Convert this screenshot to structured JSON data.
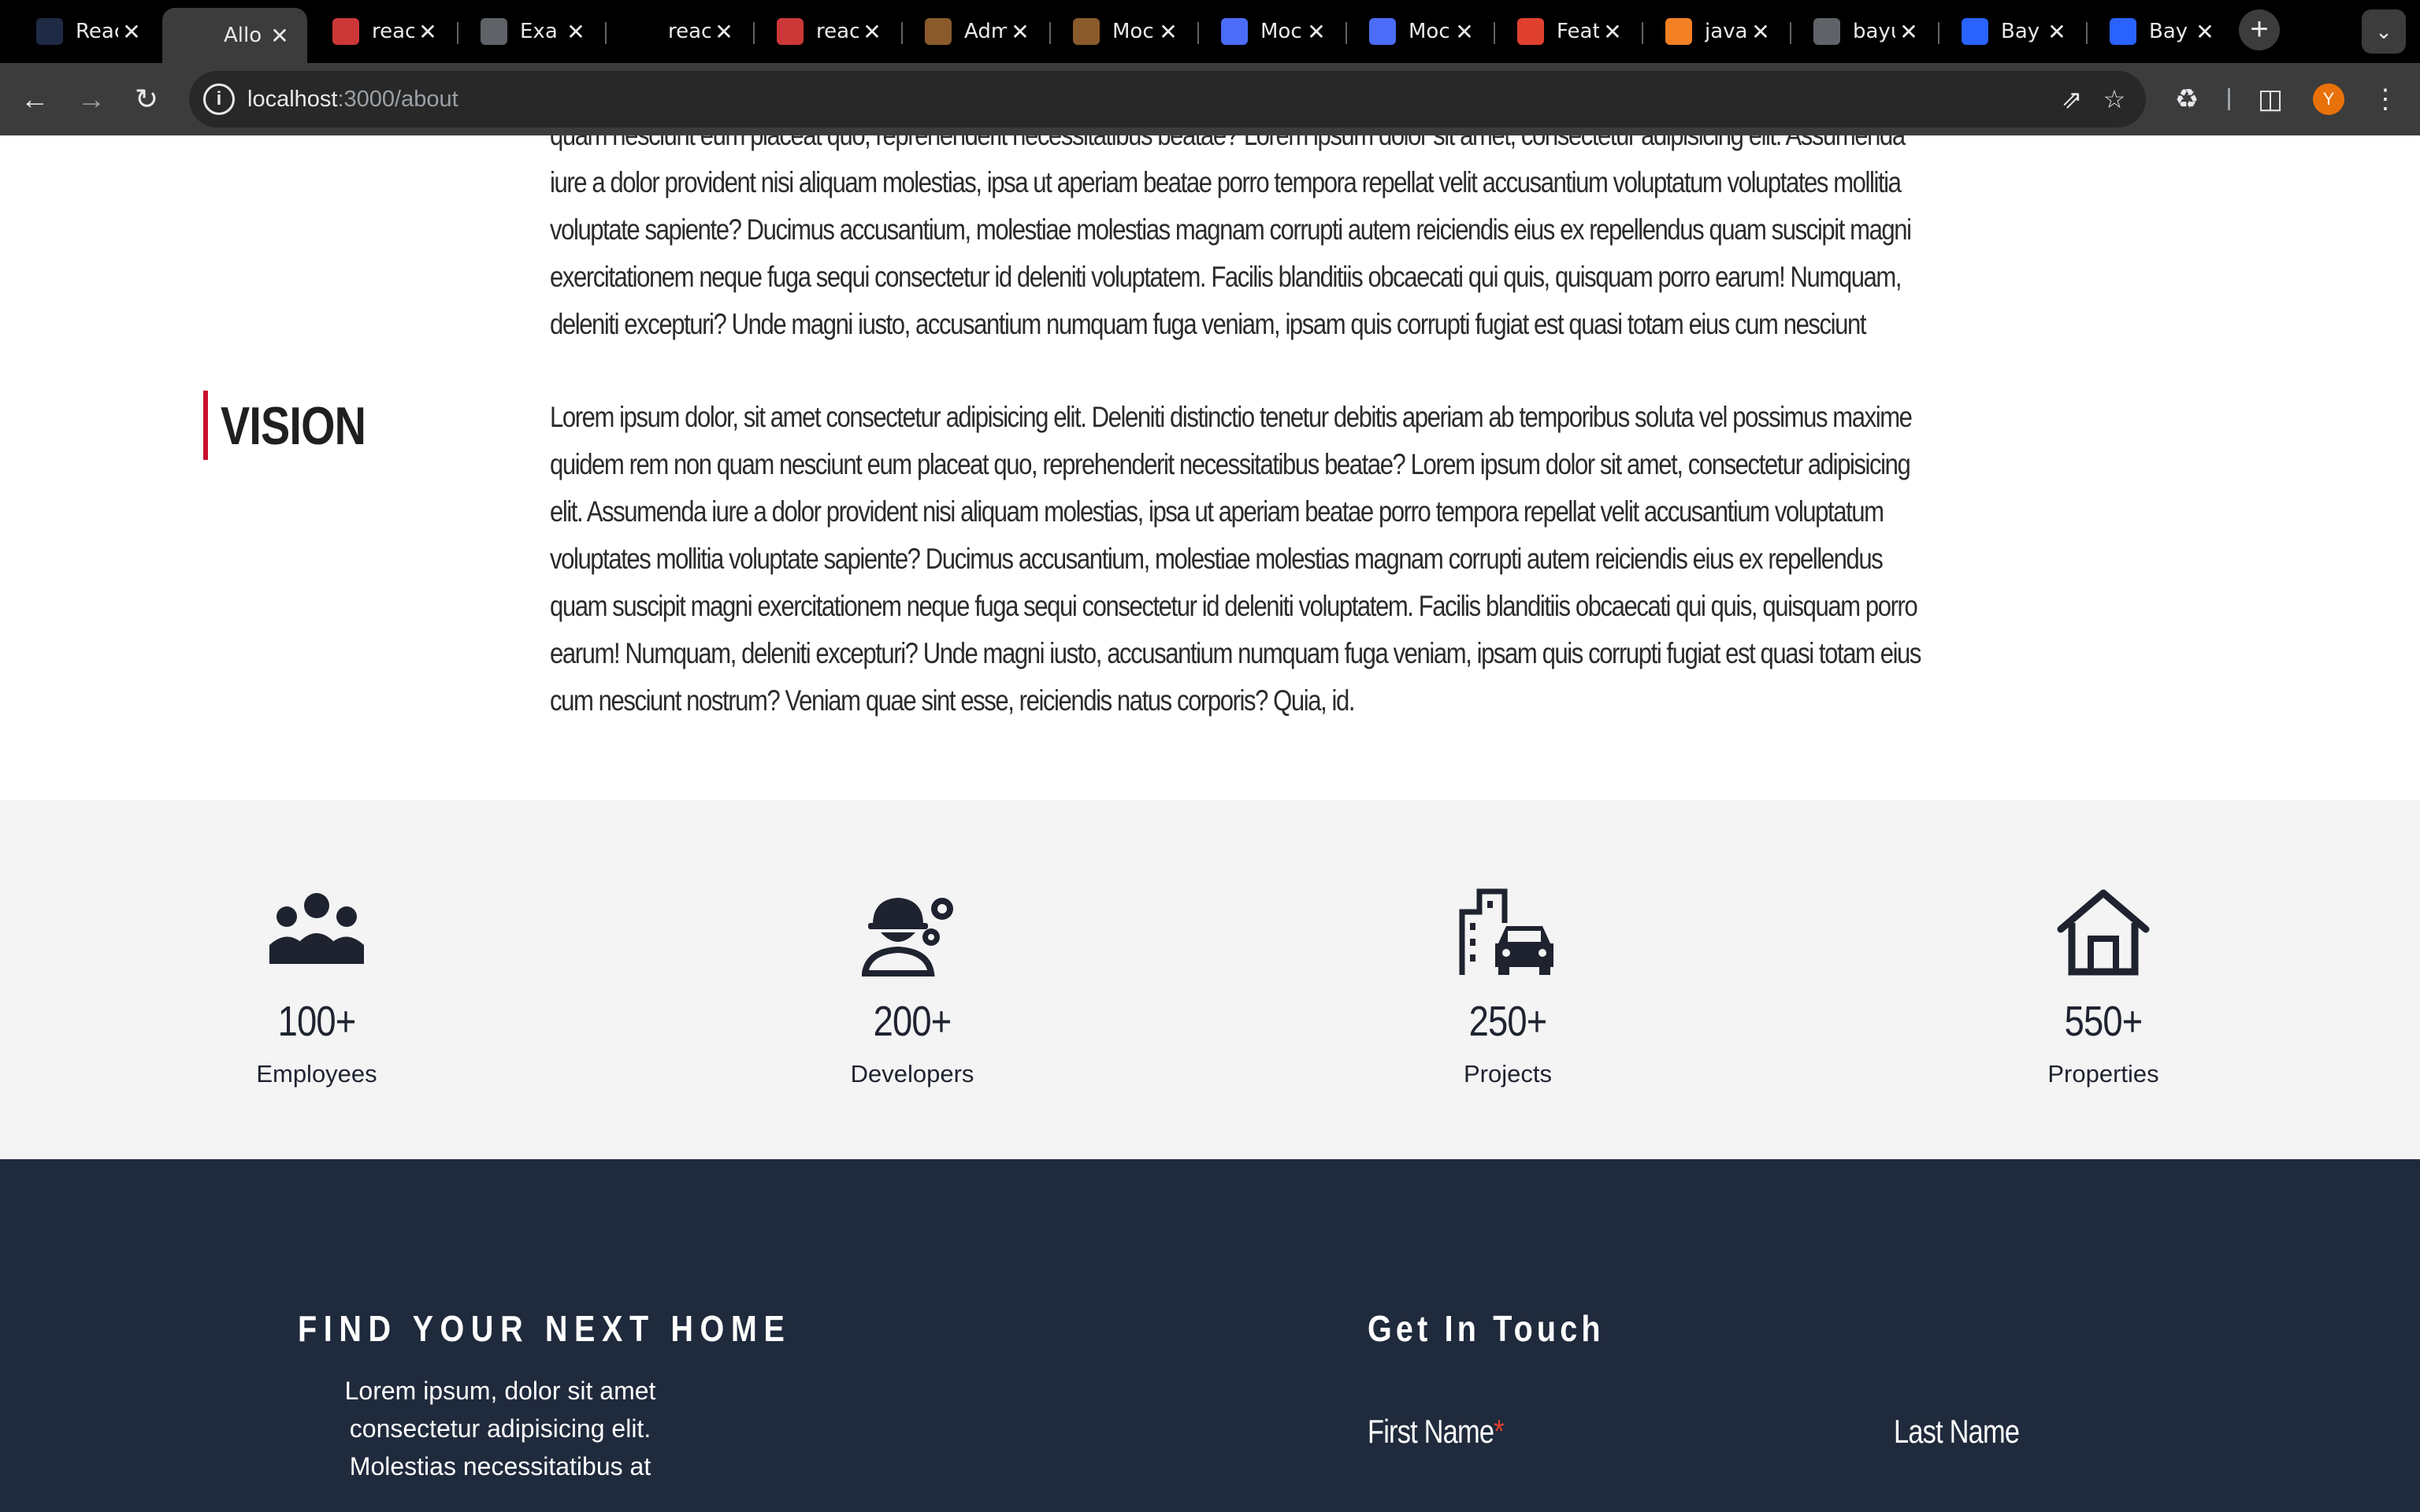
{
  "browser": {
    "tabs": [
      {
        "title": "React",
        "favicon": "react-icon",
        "color": "#1f2a44"
      },
      {
        "title": "Allo",
        "favicon": "lambda-icon",
        "color": "#3c3c3c",
        "active": true
      },
      {
        "title": "react",
        "favicon": "npm-icon",
        "color": "#cb3837"
      },
      {
        "title": "Exa",
        "favicon": "globe-icon",
        "color": "#5f6368"
      },
      {
        "title": "react",
        "favicon": "github-icon",
        "color": "#000000"
      },
      {
        "title": "react",
        "favicon": "npm-icon",
        "color": "#cb3837"
      },
      {
        "title": "Admi",
        "favicon": "notebook-icon",
        "color": "#8a5a2b"
      },
      {
        "title": "Moc",
        "favicon": "notebook-icon",
        "color": "#8a5a2b"
      },
      {
        "title": "Moc",
        "favicon": "book-icon",
        "color": "#4a6cf7"
      },
      {
        "title": "Moc",
        "favicon": "book-icon",
        "color": "#4a6cf7"
      },
      {
        "title": "Feat",
        "favicon": "arrow-icon",
        "color": "#e0412f"
      },
      {
        "title": "java",
        "favicon": "stackoverflow-icon",
        "color": "#f48024"
      },
      {
        "title": "bayu",
        "favicon": "globe-icon",
        "color": "#5f6368"
      },
      {
        "title": "Bay",
        "favicon": "search-q-icon",
        "color": "#2962ff"
      },
      {
        "title": "Bay",
        "favicon": "search-q-icon",
        "color": "#2962ff"
      }
    ],
    "url_host": "localhost",
    "url_path": ":3000/about",
    "avatar_letter": "Y"
  },
  "page": {
    "paragraph_top": "quam nesciunt eum placeat quo, reprehenderit necessitatibus beatae? Lorem ipsum dolor sit amet, consectetur adipisicing elit. Assumenda iure a dolor provident nisi aliquam molestias, ipsa ut aperiam beatae porro tempora repellat velit accusantium voluptatum voluptates mollitia voluptate sapiente? Ducimus accusantium, molestiae molestias magnam corrupti autem reiciendis eius ex repellendus quam suscipit magni exercitationem neque fuga sequi consectetur id deleniti voluptatem. Facilis blanditiis obcaecati qui quis, quisquam porro earum! Numquam, deleniti excepturi? Unde magni iusto, accusantium numquam fuga veniam, ipsam quis corrupti fugiat est quasi totam eius cum nesciunt nostrum? Veniam quae sint esse, reiciendis natus corporis? Quia, id.",
    "vision_heading": "VISION",
    "vision_text": "Lorem ipsum dolor, sit amet consectetur adipisicing elit. Deleniti distinctio tenetur debitis aperiam ab temporibus soluta vel possimus maxime quidem rem non quam nesciunt eum placeat quo, reprehenderit necessitatibus beatae? Lorem ipsum dolor sit amet, consectetur adipisicing elit. Assumenda iure a dolor provident nisi aliquam molestias, ipsa ut aperiam beatae porro tempora repellat velit accusantium voluptatum voluptates mollitia voluptate sapiente? Ducimus accusantium, molestiae molestias magnam corrupti autem reiciendis eius ex repellendus quam suscipit magni exercitationem neque fuga sequi consectetur id deleniti voluptatem. Facilis blanditiis obcaecati qui quis, quisquam porro earum! Numquam, deleniti excepturi? Unde magni iusto, accusantium numquam fuga veniam, ipsam quis corrupti fugiat est quasi totam eius cum nesciunt nostrum? Veniam quae sint esse, reiciendis natus corporis? Quia, id.",
    "accent_color": "#c8102e",
    "stats": [
      {
        "value": "100+",
        "label": "Employees",
        "icon": "people-group-icon"
      },
      {
        "value": "200+",
        "label": "Developers",
        "icon": "engineer-gears-icon"
      },
      {
        "value": "250+",
        "label": "Projects",
        "icon": "building-car-icon"
      },
      {
        "value": "550+",
        "label": "Properties",
        "icon": "house-icon"
      }
    ]
  },
  "footer": {
    "title": "FIND YOUR NEXT HOME",
    "text": "Lorem ipsum, dolor sit amet consectetur adipisicing elit. Molestias necessitatibus at",
    "contact_title": "Get In Touch",
    "first_name_label": "First Name",
    "required_mark": "*",
    "last_name_label": "Last Name",
    "background": "#1f2a3c"
  }
}
